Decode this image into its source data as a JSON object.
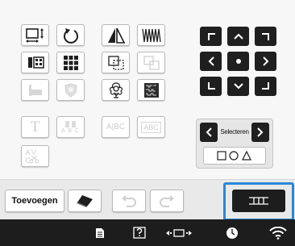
{
  "toolbar": {
    "add_label": "Toevoegen"
  },
  "select_panel": {
    "select_label": "Selecteren",
    "prev_icon": "chevron-left-icon",
    "next_icon": "chevron-right-icon",
    "shapes_icon": "square-circle-triangle-icon"
  },
  "edit_grid": {
    "text_buttons": {
      "alphabet_small": "A B C",
      "font_text": "A|BC",
      "font_text_framed": "ABC",
      "spacing_letters": "AV C"
    }
  },
  "colors": {
    "accent_blue": "#2a87d8",
    "dark": "#1d1d1d",
    "disabled": "#cfcfcf"
  }
}
